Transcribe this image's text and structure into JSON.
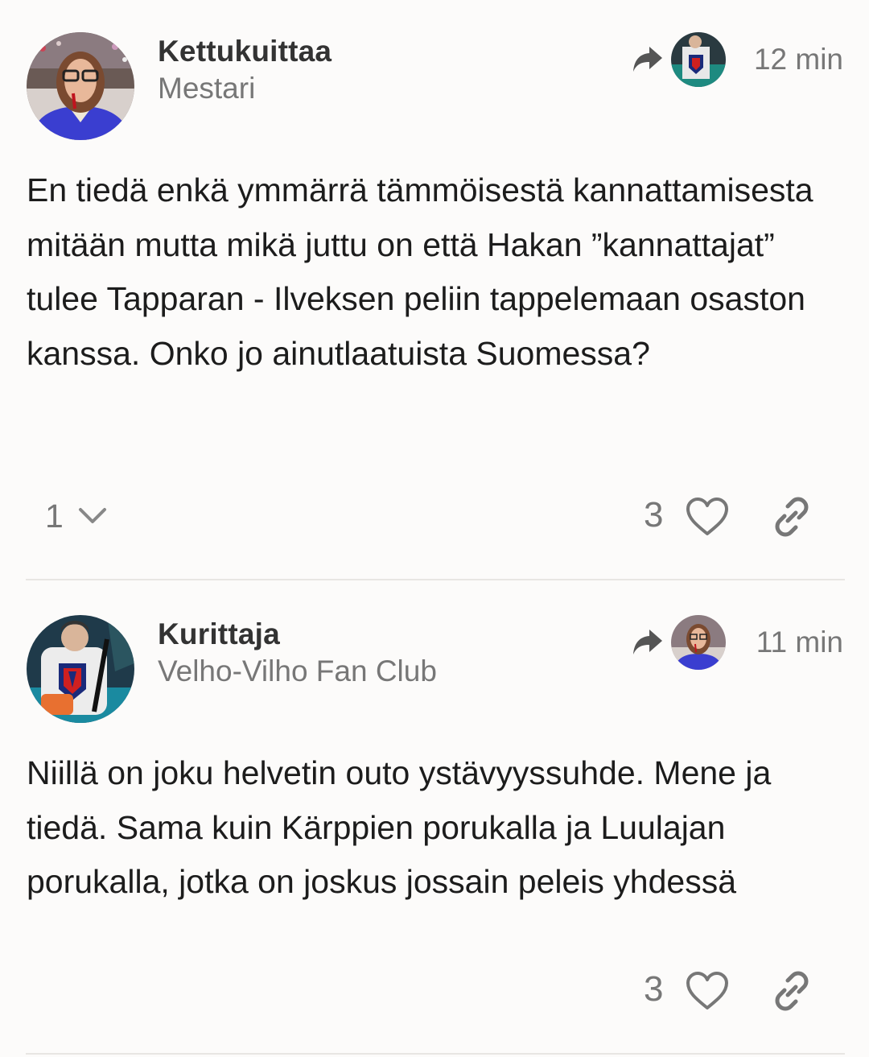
{
  "posts": [
    {
      "username": "Kettukuittaa",
      "user_title": "Mestari",
      "time": "12 min",
      "body": "En tiedä enkä ymmärrä tämmöisestä kannattamisesta mitään mutta mikä juttu on että Hakan ”kannattajat” tulee Tapparan - Ilveksen peliin tappelemaan osaston kanssa. Onko jo ainutlaatuista Suomessa?",
      "replies_count": "1",
      "likes": "3",
      "icons": {
        "reply": "reply-arrow-icon",
        "like": "heart-icon",
        "link": "link-icon",
        "expand": "chevron-down-icon"
      }
    },
    {
      "username": "Kurittaja",
      "user_title": "Velho-Vilho Fan Club",
      "time": "11 min",
      "body": "Niillä on joku helvetin outo ystävyyssuhde. Mene ja tiedä. Sama kuin Kärppien porukalla ja Luulajan porukalla, jotka on joskus jossain peleis yhdessä",
      "likes": "3",
      "icons": {
        "reply": "reply-arrow-icon",
        "like": "heart-icon",
        "link": "link-icon"
      }
    }
  ],
  "colors": {
    "background": "#fcfbfa",
    "text": "#1c1c1c",
    "muted": "#777777",
    "divider": "#e8e6e3"
  }
}
